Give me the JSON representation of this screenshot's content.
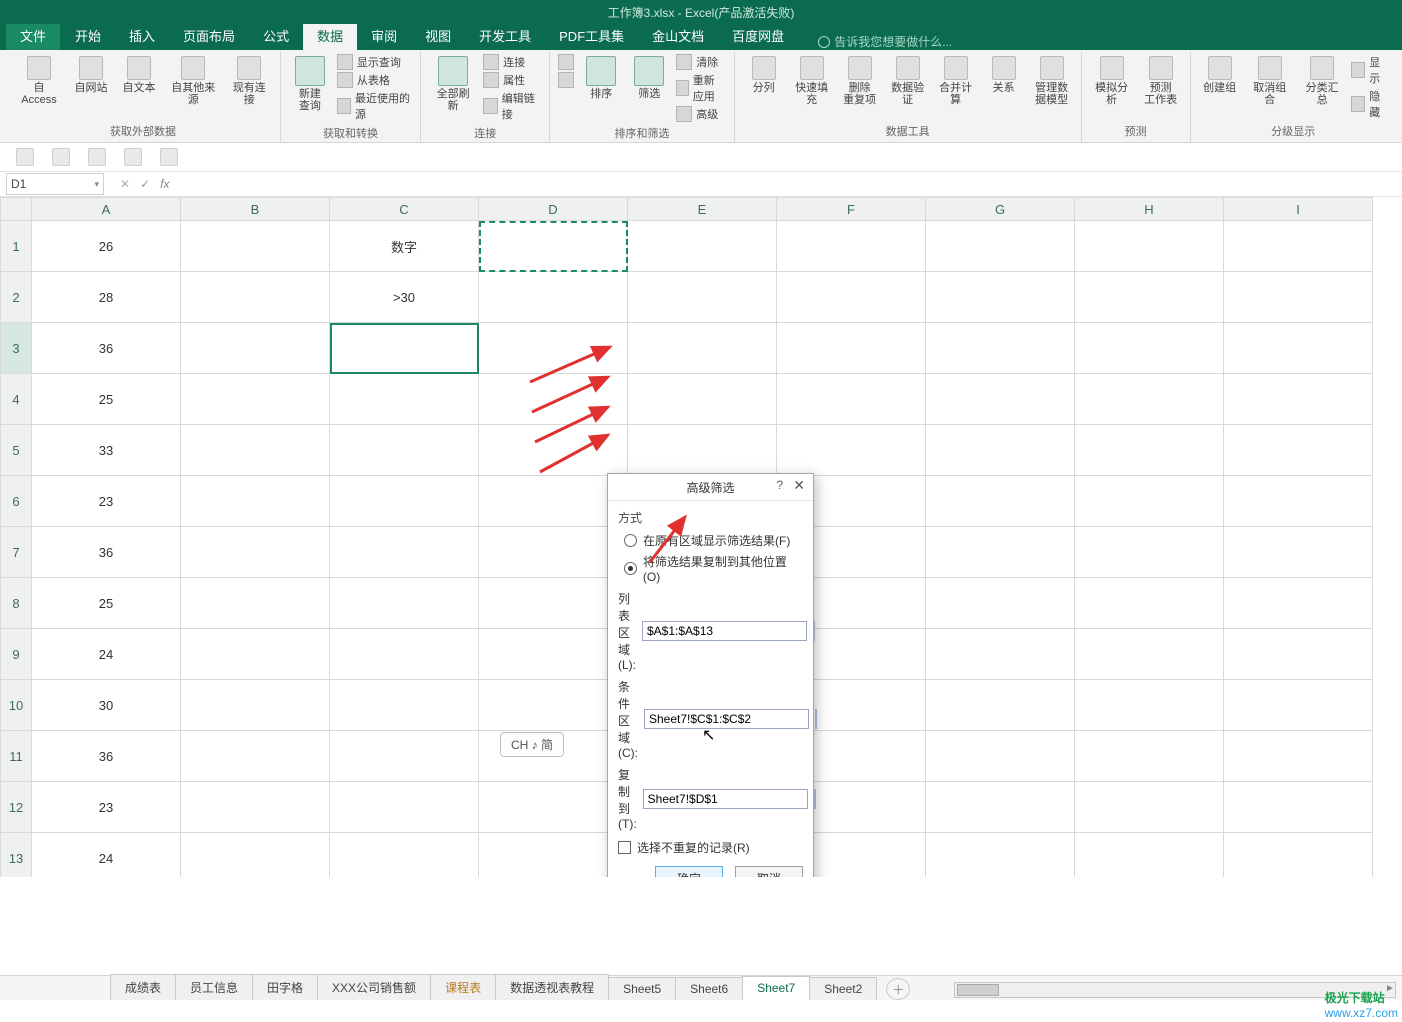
{
  "title": "工作簿3.xlsx - Excel(产品激活失败)",
  "tabs": {
    "file": "文件",
    "items": [
      "开始",
      "插入",
      "页面布局",
      "公式",
      "数据",
      "审阅",
      "视图",
      "开发工具",
      "PDF工具集",
      "金山文档",
      "百度网盘"
    ],
    "active": "数据",
    "tell_me": "告诉我您想要做什么..."
  },
  "ribbon": {
    "ext": {
      "access": "自 Access",
      "web": "自网站",
      "text": "自文本",
      "other": "自其他来源",
      "existing": "现有连接",
      "label": "获取外部数据"
    },
    "get": {
      "newq": "新建\n查询",
      "show": "显示查询",
      "table": "从表格",
      "recent": "最近使用的源",
      "label": "获取和转换"
    },
    "conn": {
      "refresh": "全部刷新",
      "conns": "连接",
      "props": "属性",
      "editl": "编辑链接",
      "label": "连接"
    },
    "sort": {
      "az": "A↓Z",
      "za": "Z↓A",
      "sort": "排序",
      "filter": "筛选",
      "clear": "清除",
      "reapply": "重新应用",
      "adv": "高级",
      "label": "排序和筛选"
    },
    "dtools": {
      "split": "分列",
      "flash": "快速填充",
      "dedup": "删除\n重复项",
      "valid": "数据验\n证",
      "consol": "合并计算",
      "rel": "关系",
      "model": "管理数\n据模型",
      "label": "数据工具"
    },
    "forecast": {
      "whatif": "模拟分析",
      "fsheet": "预测\n工作表",
      "label": "预测"
    },
    "outline": {
      "group": "创建组",
      "ungroup": "取消组合",
      "subtotal": "分类汇总",
      "showd": "显示",
      "hided": "隐藏",
      "label": "分级显示"
    }
  },
  "namebox": "D1",
  "columns": [
    "A",
    "B",
    "C",
    "D",
    "E",
    "F",
    "G",
    "H",
    "I"
  ],
  "rows": [
    1,
    2,
    3,
    4,
    5,
    6,
    7,
    8,
    9,
    10,
    11,
    12,
    13
  ],
  "cells": {
    "A": [
      26,
      28,
      36,
      25,
      33,
      23,
      36,
      25,
      24,
      30,
      36,
      23,
      24
    ],
    "C1": "数字",
    "C2": ">30"
  },
  "dialog": {
    "title": "高级筛选",
    "mode_label": "方式",
    "opt1": "在原有区域显示筛选结果(F)",
    "opt2": "将筛选结果复制到其他位置(O)",
    "list_label": "列表区域(L):",
    "list_val": "$A$1:$A$13",
    "crit_label": "条件区域(C):",
    "crit_val": "Sheet7!$C$1:$C$2",
    "copy_label": "复制到(T):",
    "copy_val": "Sheet7!$D$1",
    "unique": "选择不重复的记录(R)",
    "ok": "确定",
    "cancel": "取消"
  },
  "sheet_tabs": [
    "成绩表",
    "员工信息",
    "田字格",
    "XXX公司销售额",
    "课程表",
    "数据透视表教程",
    "Sheet5",
    "Sheet6",
    "Sheet7",
    "Sheet2"
  ],
  "active_sheet": "Sheet7",
  "hl_sheet": "课程表",
  "ime": "CH ♪ 简",
  "watermark": {
    "brand": "极光下载站",
    "url": "www.xz7.com"
  }
}
